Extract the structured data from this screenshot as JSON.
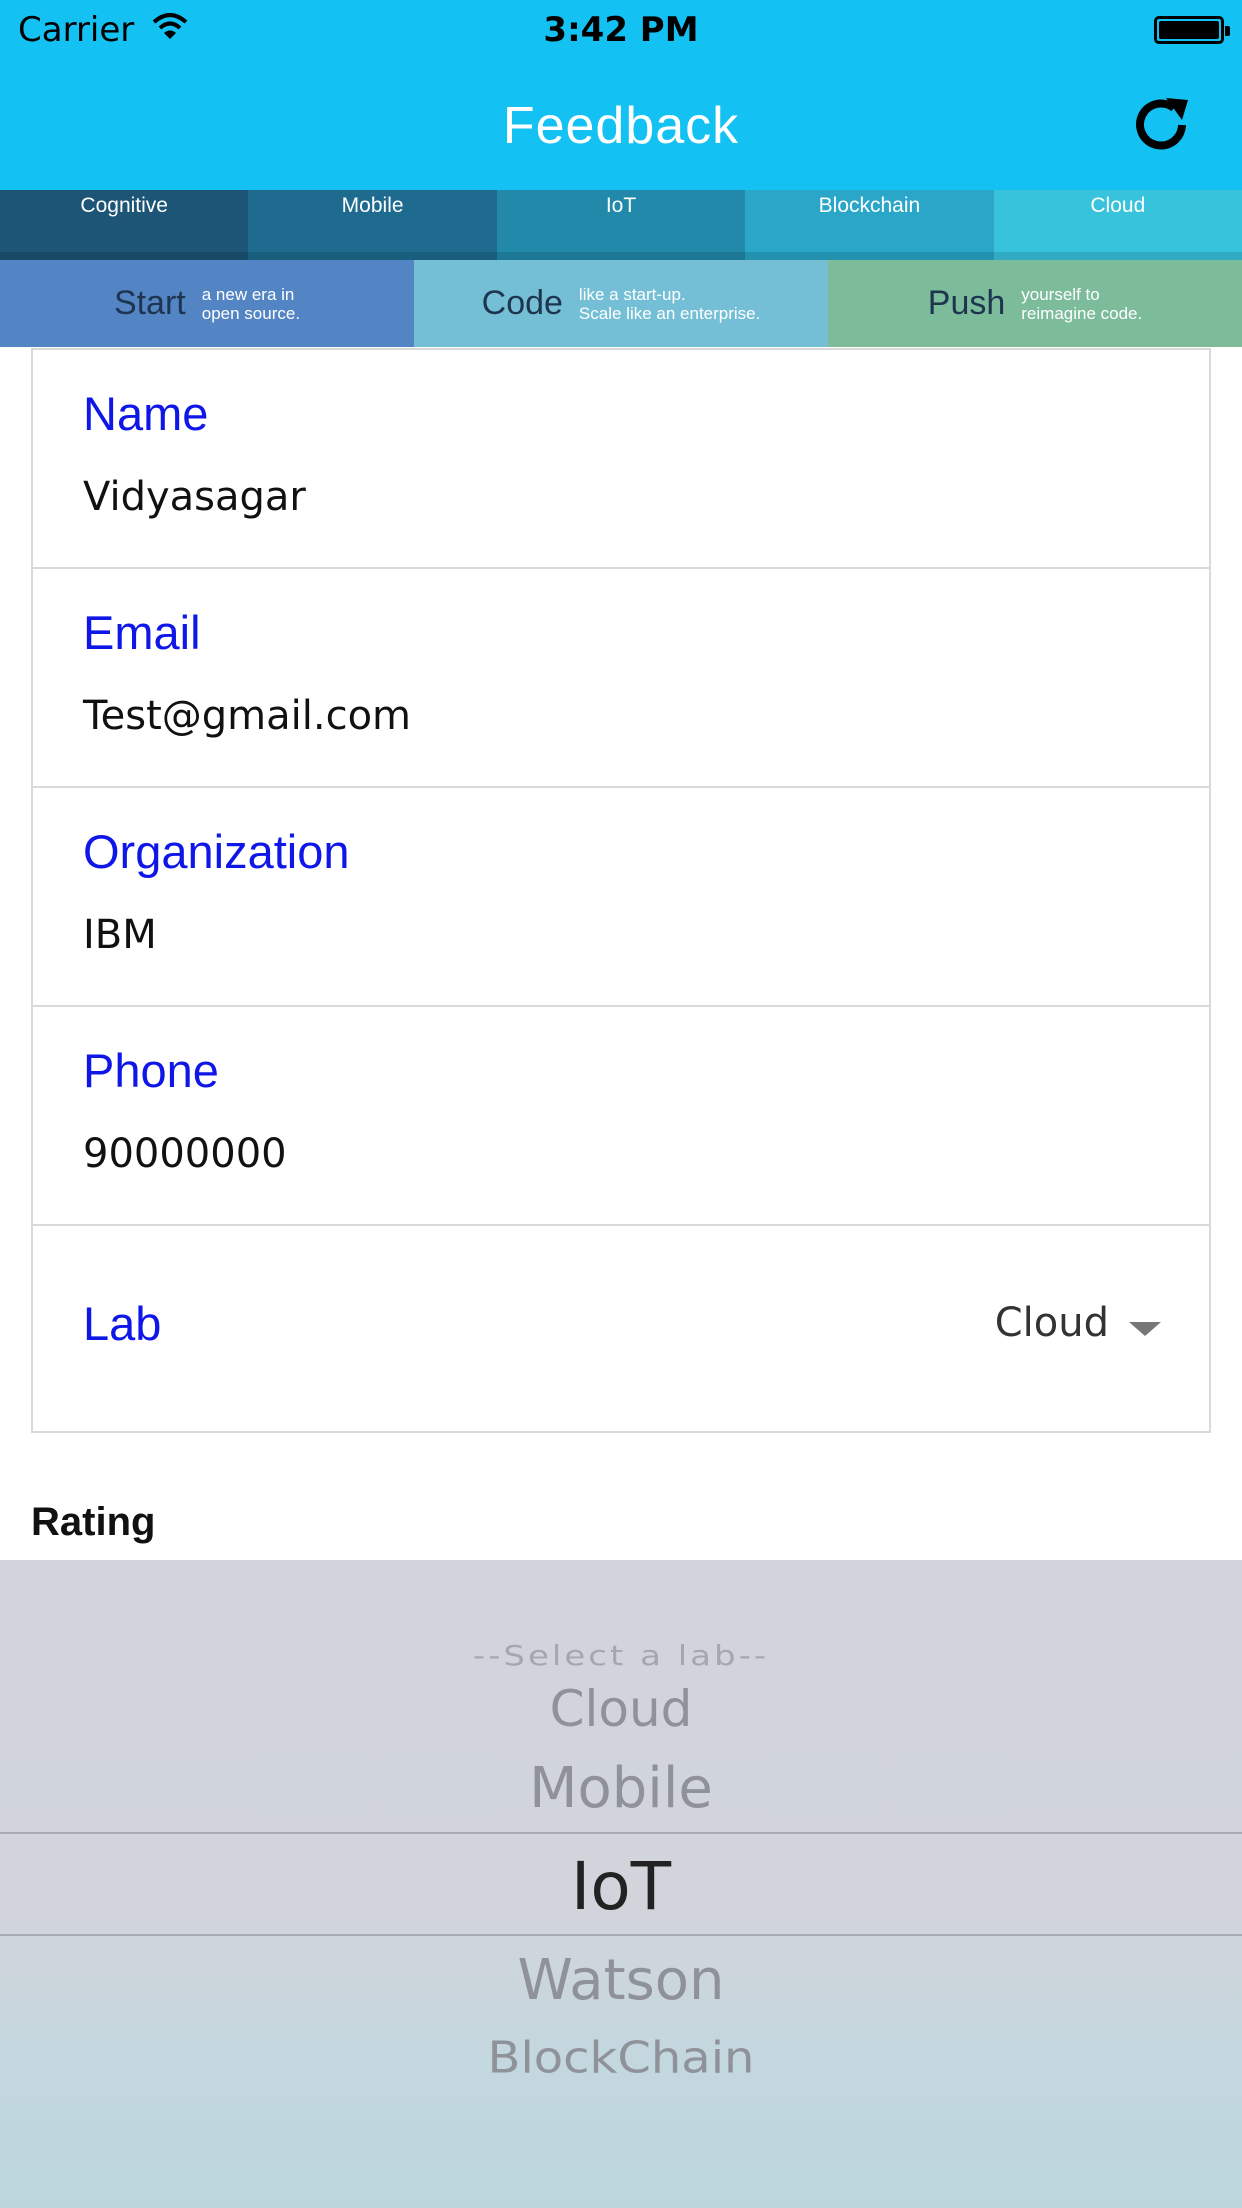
{
  "status_bar": {
    "carrier": "Carrier",
    "time": "3:42 PM"
  },
  "nav": {
    "title": "Feedback",
    "refresh_icon": "refresh-icon"
  },
  "banner": {
    "tabs": [
      {
        "label": "Cognitive",
        "color": "#1c5576"
      },
      {
        "label": "Mobile",
        "color": "#1e6b8f"
      },
      {
        "label": "IoT",
        "color": "#2289aa"
      },
      {
        "label": "Blockchain",
        "color": "#2aa7c8"
      },
      {
        "label": "Cloud",
        "color": "#38c3dc"
      }
    ],
    "promos": [
      {
        "big": "Start",
        "small1": "a new era in",
        "small2": "open source.",
        "color": "#5385c4"
      },
      {
        "big": "Code",
        "small1": "like a start-up.",
        "small2": "Scale like an enterprise.",
        "color": "#74bfd6"
      },
      {
        "big": "Push",
        "small1": "yourself to",
        "small2": "reimagine code.",
        "color": "#7cbc9b"
      }
    ]
  },
  "form": {
    "name": {
      "label": "Name",
      "value": "Vidyasagar"
    },
    "email": {
      "label": "Email",
      "value": "Test@gmail.com"
    },
    "organization": {
      "label": "Organization",
      "value": "IBM"
    },
    "phone": {
      "label": "Phone",
      "value": "90000000"
    },
    "lab": {
      "label": "Lab",
      "value": "Cloud"
    }
  },
  "rating": {
    "label": "Rating"
  },
  "picker": {
    "options": [
      "--Select a lab--",
      "Cloud",
      "Mobile",
      "IoT",
      "Watson",
      "BlockChain"
    ],
    "selected": "IoT"
  },
  "colors": {
    "accent": "#13c1f2",
    "label_blue": "#0f16e8"
  }
}
